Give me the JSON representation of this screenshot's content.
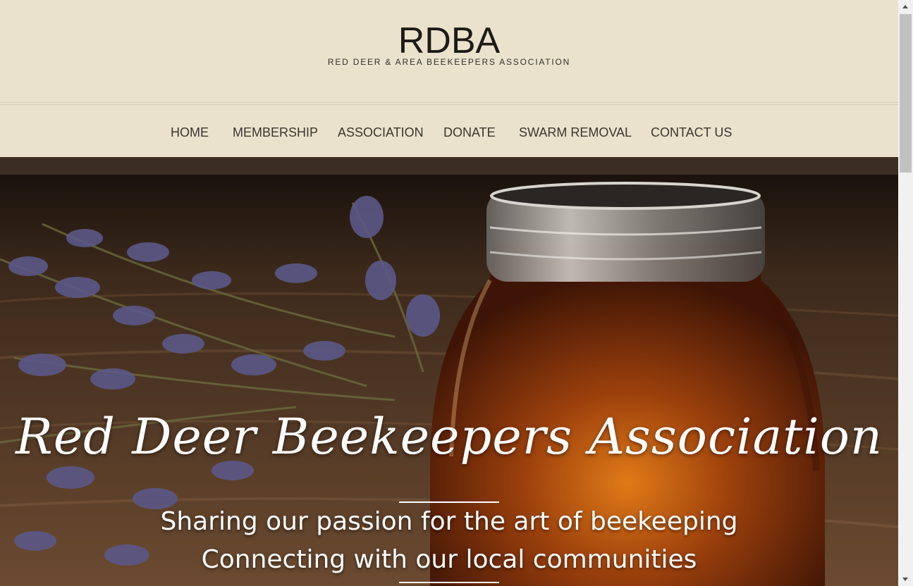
{
  "site": {
    "logo": "RDBA",
    "tagline": "RED DEER & AREA BEEKEEPERS ASSOCIATION"
  },
  "nav": {
    "items": [
      {
        "label": "HOME"
      },
      {
        "label": "MEMBERSHIP"
      },
      {
        "label": "ASSOCIATION"
      },
      {
        "label": "DONATE"
      },
      {
        "label": "SWARM REMOVAL"
      },
      {
        "label": "CONTACT US"
      }
    ]
  },
  "hero": {
    "title": "Red Deer Beekeepers Association",
    "line1": "Sharing our passion for the art of beekeeping",
    "line2": "Connecting with our local communities"
  },
  "colors": {
    "background": "#ebe2cd",
    "dark_band": "#3a2d22",
    "text": "#3a3630",
    "hero_text": "#ffffff"
  }
}
